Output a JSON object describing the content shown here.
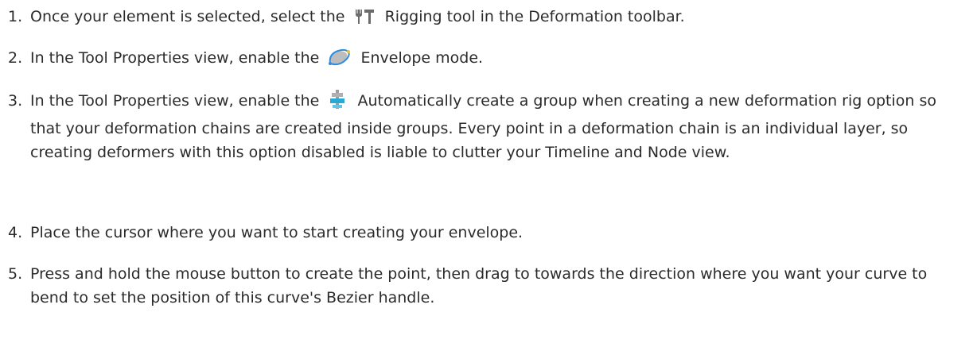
{
  "steps": [
    {
      "number": "1.",
      "before": "Once your element is selected, select the",
      "icon": "rigging-tool-icon",
      "after": "Rigging tool in the Deformation toolbar."
    },
    {
      "number": "2.",
      "before": "In the Tool Properties view, enable the",
      "icon": "envelope-mode-icon",
      "after": "Envelope mode."
    },
    {
      "number": "3.",
      "before": "In the Tool Properties view, enable the",
      "icon": "auto-group-icon",
      "after": "Automatically create a group when creating a new deformation rig option so that your deformation chains are created inside groups. Every point in a deformation chain is an individual layer, so creating deformers with this option disabled is liable to clutter your Timeline and Node view."
    },
    {
      "number": "4.",
      "text": "Place the cursor where you want to start creating your envelope."
    },
    {
      "number": "5.",
      "text": "Press and hold the mouse button to create the point, then drag to towards the direction where you want your curve to bend to set the position of this curve's Bezier handle."
    }
  ]
}
